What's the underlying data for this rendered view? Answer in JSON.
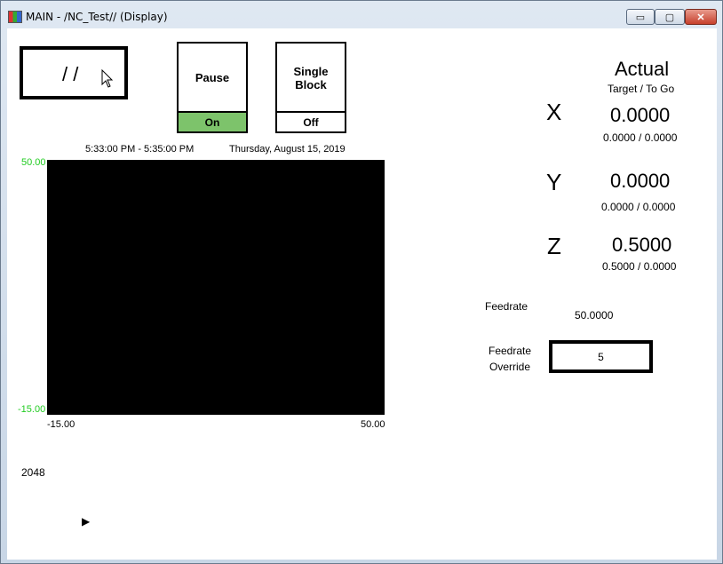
{
  "window": {
    "title": "MAIN - /NC_Test// (Display)",
    "minimize_glyph": "▭",
    "maximize_glyph": "▢",
    "close_glyph": "✕"
  },
  "status_box": {
    "text": "/ /"
  },
  "pause": {
    "label": "Pause",
    "state": "On",
    "state_color": "#7dc36b"
  },
  "single_block": {
    "label": "Single\nBlock",
    "state": "Off"
  },
  "plot": {
    "time_range": "5:33:00 PM - 5:35:00 PM",
    "date": "Thursday, August 15, 2019",
    "y_max": "50.00",
    "y_min": "-15.00",
    "x_min": "-15.00",
    "x_max": "50.00"
  },
  "header": {
    "actual": "Actual",
    "target_to_go": "Target / To Go"
  },
  "axes": [
    {
      "name": "X",
      "actual": "0.0000",
      "target_to_go": "0.0000 / 0.0000"
    },
    {
      "name": "Y",
      "actual": "0.0000",
      "target_to_go": "0.0000 / 0.0000"
    },
    {
      "name": "Z",
      "actual": "0.5000",
      "target_to_go": "0.5000 / 0.0000"
    }
  ],
  "feedrate": {
    "label": "Feedrate",
    "value": "50.0000"
  },
  "feedrate_override": {
    "label": "Feedrate\nOverride",
    "value": "5"
  },
  "counter": "2048",
  "play_glyph": "▶"
}
